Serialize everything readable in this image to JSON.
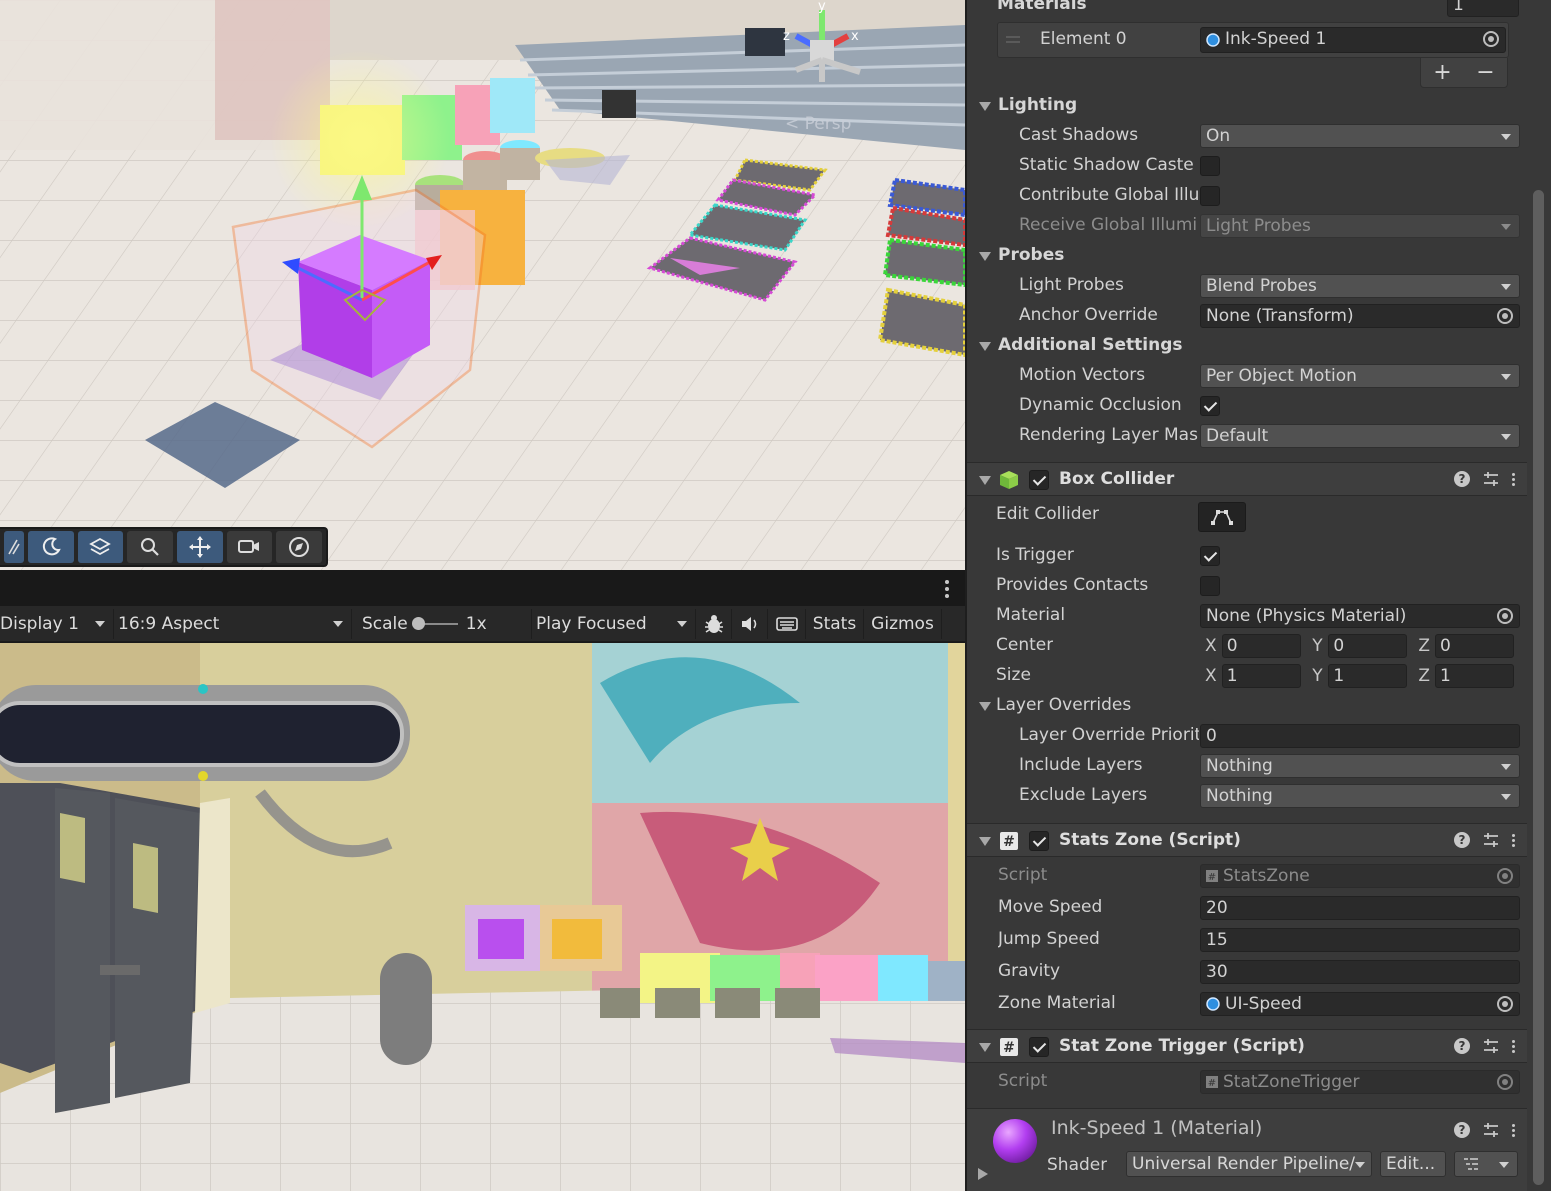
{
  "scene": {
    "persp_label": "< Persp",
    "gizmo_axes": {
      "x": "x",
      "y": "y",
      "z": "z"
    },
    "toolbar_tools": [
      "grid-icon",
      "moon-icon",
      "layers-icon",
      "search-icon",
      "move-tool-icon",
      "camera-icon",
      "compass-icon"
    ]
  },
  "game": {
    "display": "Display 1",
    "aspect": "16:9 Aspect",
    "scale_label": "Scale",
    "scale_value": "1x",
    "play_mode": "Play Focused",
    "stats_label": "Stats",
    "gizmos_label": "Gizmos"
  },
  "inspector": {
    "materials_header": "Materials",
    "materials_count": "1",
    "element0_label": "Element 0",
    "element0_value": "Ink-Speed 1",
    "lighting": {
      "title": "Lighting",
      "cast_shadows_label": "Cast Shadows",
      "cast_shadows_value": "On",
      "static_shadow_label": "Static Shadow Caste",
      "contribute_gi_label": "Contribute Global Illu",
      "receive_gi_label": "Receive Global Illumi",
      "receive_gi_value": "Light Probes"
    },
    "probes": {
      "title": "Probes",
      "light_probes_label": "Light Probes",
      "light_probes_value": "Blend Probes",
      "anchor_override_label": "Anchor Override",
      "anchor_override_value": "None (Transform)"
    },
    "additional": {
      "title": "Additional Settings",
      "motion_vectors_label": "Motion Vectors",
      "motion_vectors_value": "Per Object Motion",
      "dynamic_occlusion_label": "Dynamic Occlusion",
      "rendering_layer_label": "Rendering Layer Mas",
      "rendering_layer_value": "Default"
    },
    "box_collider": {
      "title": "Box Collider",
      "edit_collider_label": "Edit Collider",
      "is_trigger_label": "Is Trigger",
      "provides_contacts_label": "Provides Contacts",
      "material_label": "Material",
      "material_value": "None (Physics Material)",
      "center_label": "Center",
      "center": {
        "x": "0",
        "y": "0",
        "z": "0"
      },
      "size_label": "Size",
      "size": {
        "x": "1",
        "y": "1",
        "z": "1"
      },
      "axis_x": "X",
      "axis_y": "Y",
      "axis_z": "Z",
      "layer_overrides_title": "Layer Overrides",
      "layer_override_priority_label": "Layer Override Priorit",
      "layer_override_priority_value": "0",
      "include_layers_label": "Include Layers",
      "include_layers_value": "Nothing",
      "exclude_layers_label": "Exclude Layers",
      "exclude_layers_value": "Nothing"
    },
    "stats_zone": {
      "title": "Stats Zone (Script)",
      "script_label": "Script",
      "script_value": "StatsZone",
      "move_speed_label": "Move Speed",
      "move_speed_value": "20",
      "jump_speed_label": "Jump Speed",
      "jump_speed_value": "15",
      "gravity_label": "Gravity",
      "gravity_value": "30",
      "zone_material_label": "Zone Material",
      "zone_material_value": "UI-Speed"
    },
    "stat_zone_trigger": {
      "title": "Stat Zone Trigger (Script)",
      "script_label": "Script",
      "script_value": "StatZoneTrigger"
    },
    "material_footer": {
      "name": "Ink-Speed 1 (Material)",
      "shader_label": "Shader",
      "shader_value": "Universal Render Pipeline/",
      "edit_label": "Edit..."
    }
  }
}
